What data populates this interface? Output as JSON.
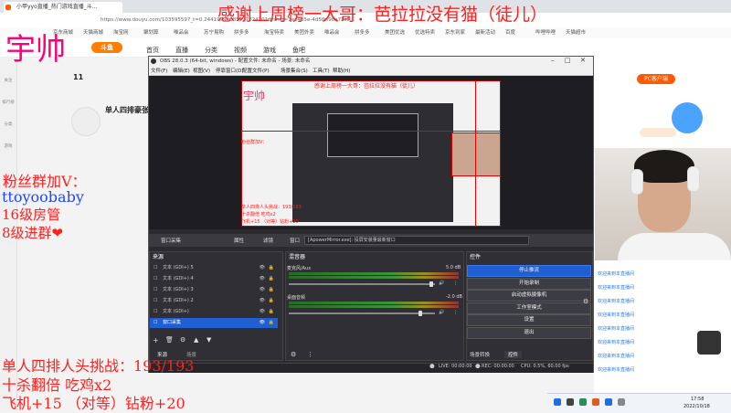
{
  "browser": {
    "tab_title": "小甲yyo直播_热门游戏直播_斗…",
    "url": "https://www.douyu.com/103595597_t=0.2441979468577782470?dyshid=1ee4d5e-4d5fbf98a72c5…",
    "bookmarks": [
      "京东商城",
      "天猫商城",
      "淘宝网",
      "聚划算",
      "唯品会",
      "苏宁易购",
      "拼多多",
      "淘宝特卖",
      "美团外卖",
      "唯品会",
      "拼多多",
      "美团优选",
      "优选特卖",
      "京东到家",
      "最新活动",
      "百度",
      "哔哩哔哩",
      "天猫超市"
    ]
  },
  "site": {
    "logo": "斗鱼",
    "nav": [
      "首页",
      "直播",
      "分类",
      "视频",
      "游戏",
      "鱼吧"
    ],
    "room_title": "单人四排豪张",
    "follow_count": "11",
    "pc_client": "PC客户端",
    "sidebar": [
      "关注",
      "排行榜",
      "分类",
      "游戏"
    ]
  },
  "chat": [
    {
      "name": "欢迎来到本直播间",
      "text": ""
    },
    {
      "name": "欢迎来到本直播间",
      "text": ""
    },
    {
      "name": "欢迎来到本直播间",
      "text": ""
    },
    {
      "name": "欢迎来到本直播间",
      "text": ""
    },
    {
      "name": "欢迎来到本直播间",
      "text": ""
    },
    {
      "name": "欢迎来到本直播间",
      "text": ""
    },
    {
      "name": "欢迎来到本直播间",
      "text": ""
    },
    {
      "name": "欢迎来到本直播间",
      "text": ""
    }
  ],
  "obs": {
    "title": "OBS 28.0.3 (64-bit, windows) - 配置文件: 未命名 - 场景: 未命名",
    "menu": [
      "文件(F)",
      "编辑(E)",
      "视图(V)",
      "停靠窗口(D)",
      "配置文件(P)",
      "场景集合(S)",
      "工具(T)",
      "帮助(H)"
    ],
    "toolbar": {
      "window_capture": "窗口采集",
      "properties": "属性",
      "filters": "滤镜",
      "window_label": "窗口",
      "window_value": "[ApowerMirror.exe]: 投屏安装量最新窗口"
    },
    "sources_header": "来源",
    "sources": [
      "文本 (GDI+) 5",
      "文本 (GDI+) 4",
      "文本 (GDI+) 3",
      "文本 (GDI+) 2",
      "文本 (GDI+)",
      "窗口采集"
    ],
    "mixer_header": "混音器",
    "mixer": [
      {
        "name": "麦克风/Aux",
        "db": "5.0 dB"
      },
      {
        "name": "桌面音频",
        "db": "-2.0 dB"
      }
    ],
    "controls_header": "控件",
    "controls": [
      "停止推流",
      "开始录制",
      "启动虚拟摄像机",
      "工作室模式",
      "设置",
      "退出"
    ],
    "tabs": [
      "来源",
      "场景"
    ],
    "dock_tabs": [
      "场景转换",
      "控件"
    ],
    "status": {
      "live": "LIVE: 00:00:00",
      "rec": "REC: 00:00:00",
      "cpu": "CPU: 0.5%, 60.00 fps"
    }
  },
  "overlays": {
    "top_thanks": "感谢上周榜一大哥：芭拉拉没有猫（徒儿）",
    "streamer": "宇帅",
    "fan_group": "粉丝群加V：",
    "wechat_id": "ttoyoobaby",
    "room_mgr": "16级房管",
    "group_level": "8级进群❤",
    "challenge": "单人四排人头挑战：193/193",
    "ten_kill": "十杀翻倍  吃鸡x2",
    "plane": "飞机+15  （对等）钻粉+20"
  },
  "taskbar": {
    "time": "17:58",
    "date": "2022/10/18"
  }
}
